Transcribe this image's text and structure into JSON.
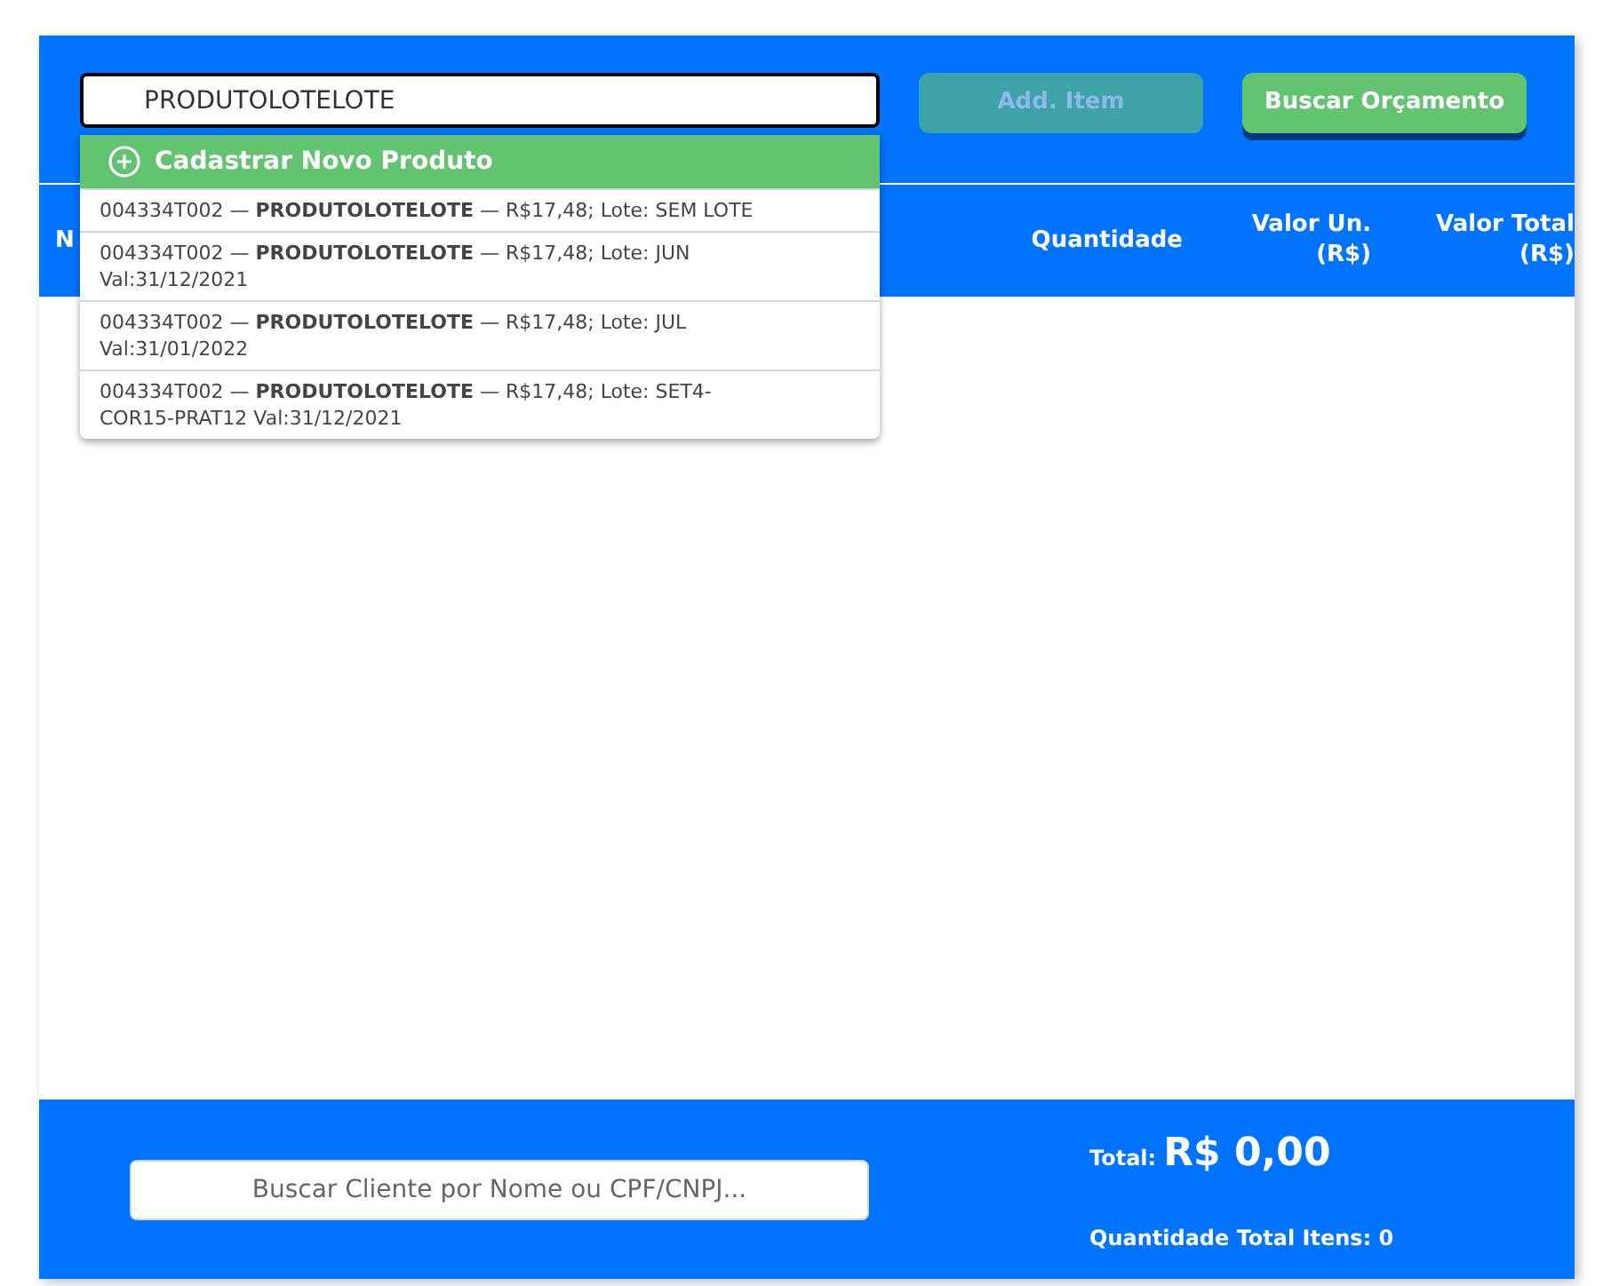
{
  "search": {
    "value": "PRODUTOLOTELOTE"
  },
  "buttons": [
    {
      "label": "Add. Item",
      "disabled": true
    },
    {
      "label": "Buscar Orçamento",
      "disabled": false
    }
  ],
  "dropdown": {
    "new_item": "Cadastrar Novo Produto",
    "results": [
      {
        "code": "004334T002 — ",
        "name": "PRODUTOLOTELOTE",
        "detail": " — R$17,48; Lote: SEM LOTE"
      },
      {
        "code": "004334T002 — ",
        "name": "PRODUTOLOTELOTE",
        "detail": " — R$17,48; Lote: JUN Val:31/12/2021"
      },
      {
        "code": "004334T002 — ",
        "name": "PRODUTOLOTELOTE",
        "detail": " — R$17,48; Lote: JUL Val:31/01/2022"
      },
      {
        "code": "004334T002 — ",
        "name": "PRODUTOLOTELOTE",
        "detail": " — R$17,48; Lote: SET4-COR15-PRAT12 Val:31/12/2021"
      }
    ]
  },
  "table": {
    "columns": [
      "N",
      "Quantidade",
      "Valor Un. (R$)",
      "Valor Total (R$)"
    ]
  },
  "footer": {
    "client_search": {
      "placeholder": "Buscar Cliente por Nome ou CPF/CNPJ..."
    },
    "total_label": "Total:",
    "total_value": "R$ 0,00",
    "quantity": "Quantidade Total Itens: 0"
  }
}
